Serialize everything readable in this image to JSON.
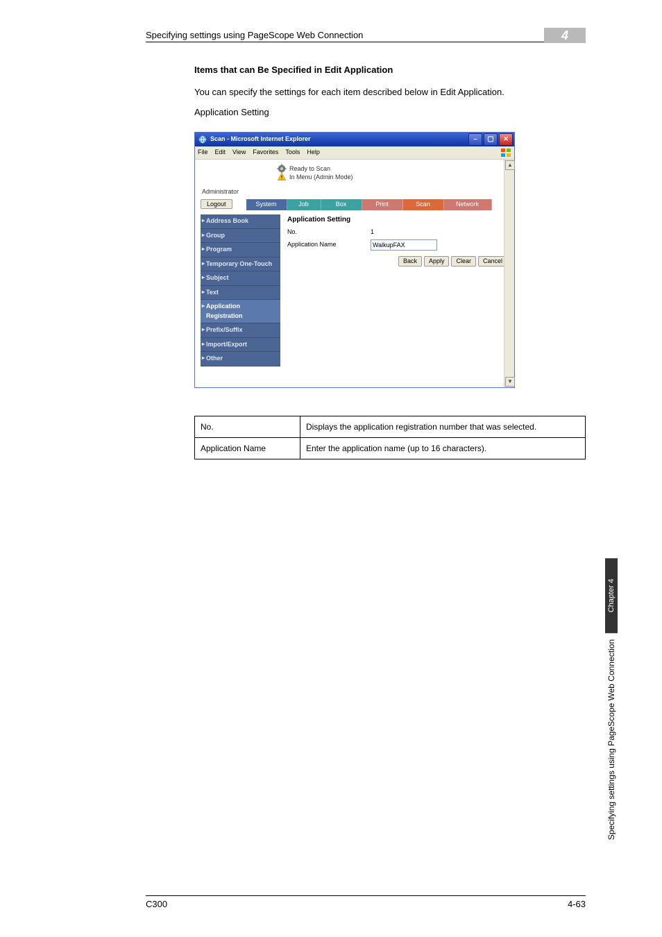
{
  "header": {
    "title": "Specifying settings using PageScope Web Connection",
    "chapter": "4"
  },
  "section": {
    "heading": "Items that can Be Specified in Edit Application",
    "body": "You can specify the settings for each item described below in Edit Application.",
    "sub": "Application Setting"
  },
  "ie": {
    "window_title": "Scan - Microsoft Internet Explorer",
    "menus": [
      "File",
      "Edit",
      "View",
      "Favorites",
      "Tools",
      "Help"
    ],
    "status1": "Ready to Scan",
    "status2": "In Menu (Admin Mode)",
    "user": "Administrator",
    "logout": "Logout",
    "tabs": {
      "system": "System",
      "job": "Job",
      "box": "Box",
      "print": "Print",
      "scan": "Scan",
      "network": "Network"
    },
    "side": {
      "address": "Address Book",
      "group": "Group",
      "program": "Program",
      "temp": "Temporary One-Touch",
      "subject": "Subject",
      "text": "Text",
      "appreg": "Application Registration",
      "prefix": "Prefix/Suffix",
      "impexp": "Import/Export",
      "other": "Other"
    },
    "detail": {
      "title": "Application Setting",
      "no_label": "No.",
      "no_value": "1",
      "name_label": "Application Name",
      "name_value": "WalkupFAX",
      "buttons": {
        "back": "Back",
        "apply": "Apply",
        "clear": "Clear",
        "cancel": "Cancel"
      }
    }
  },
  "params": [
    {
      "key": "No.",
      "desc": "Displays the application registration number that was selected."
    },
    {
      "key": "Application Name",
      "desc": "Enter the application name (up to 16 characters)."
    }
  ],
  "sidebar": {
    "chapter": "Chapter 4",
    "text": "Specifying settings using PageScope Web Connection"
  },
  "footer": {
    "left": "C300",
    "right": "4-63"
  }
}
